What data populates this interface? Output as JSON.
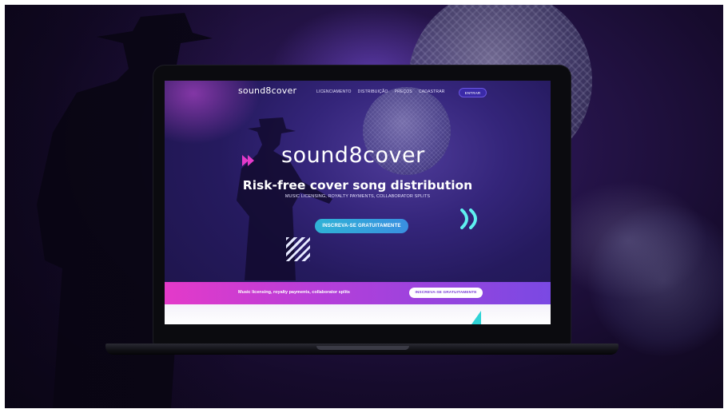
{
  "colors": {
    "accent_teal": "#2fb3d6",
    "accent_pink": "#e43ac9",
    "accent_purple": "#7a49e3",
    "nav_button": "#3a2aa8"
  },
  "site": {
    "logo_small": "sound8cover",
    "nav": {
      "links": [
        "LICENCIAMENTO",
        "DISTRIBUIÇÃO",
        "PREÇOS",
        "CADASTRAR"
      ],
      "login_button": "ENTRAR"
    },
    "hero": {
      "logo": "sound8cover",
      "title": "Risk-free cover song distribution",
      "subtitle": "MUSIC LICENSING, ROYALTY PAYMENTS, COLLABORATOR SPLITS",
      "cta": "INSCREVA-SE GRATUITAMENTE"
    },
    "band": {
      "text": "Music licensing, royalty payments, collaborator splits",
      "cta": "INSCREVA-SE GRATUITAMENTE"
    }
  },
  "icons": [
    "double-play-icon",
    "double-chevron-icon",
    "diagonal-stripes-icon"
  ]
}
